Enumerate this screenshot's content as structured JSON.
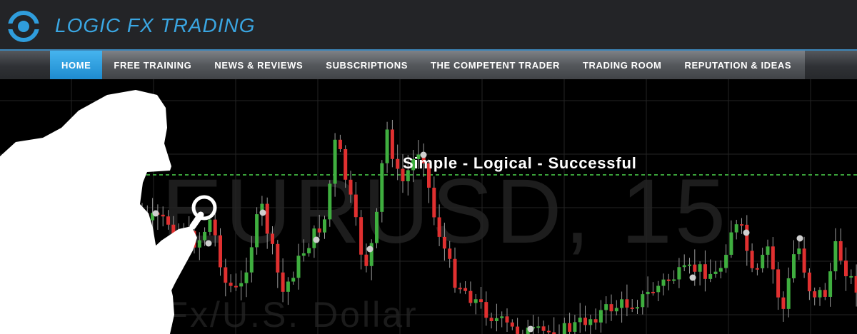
{
  "brand": {
    "name": "LOGIC FX TRADING",
    "logo_icon": "eye-ring-icon",
    "accent_color": "#3aa6e2"
  },
  "nav": {
    "items": [
      {
        "label": "HOME",
        "active": true
      },
      {
        "label": "FREE TRAINING",
        "active": false
      },
      {
        "label": "NEWS & REVIEWS",
        "active": false
      },
      {
        "label": "SUBSCRIPTIONS",
        "active": false
      },
      {
        "label": "THE COMPETENT TRADER",
        "active": false
      },
      {
        "label": "TRADING ROOM",
        "active": false
      },
      {
        "label": "REPUTATION & IDEAS",
        "active": false
      }
    ]
  },
  "hero": {
    "tagline": "Simple - Logical - Successful",
    "watermark_symbol": "EURUSD, 15",
    "watermark_name": "Euro Fx/U.S. Dollar",
    "figure_icon": "detective-magnifier-icon",
    "bull_color": "#3fae3f",
    "bear_color": "#e03030"
  }
}
